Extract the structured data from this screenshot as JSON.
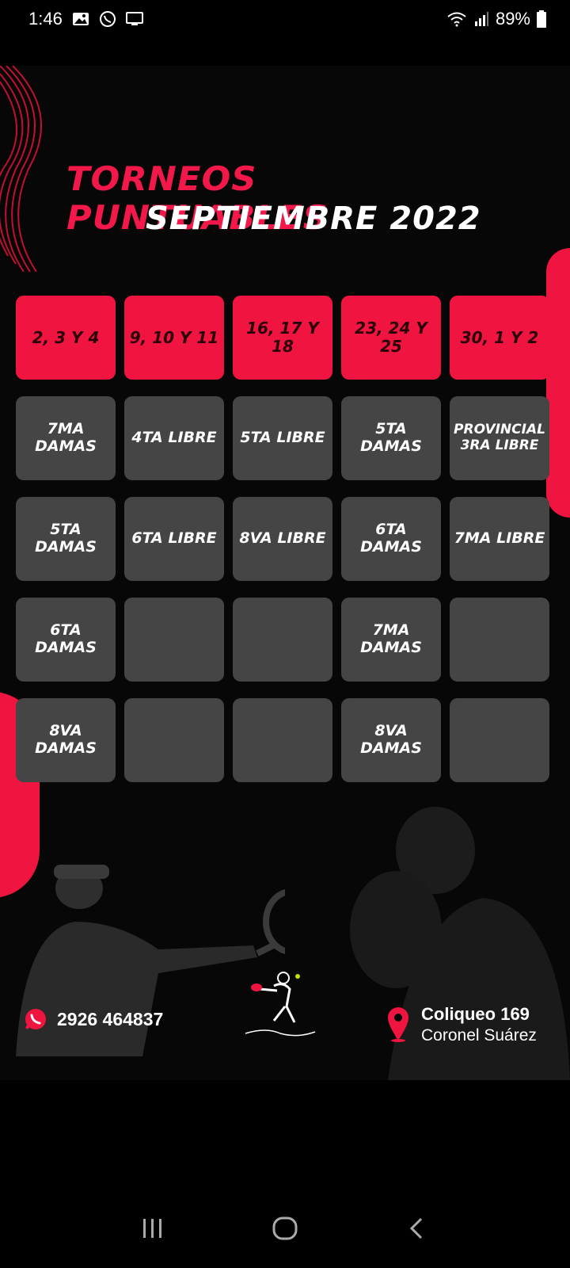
{
  "status_bar": {
    "time": "1:46",
    "battery": "89%",
    "icons": [
      "gallery-icon",
      "whatsapp-icon",
      "cast-icon",
      "wifi-icon",
      "signal-icon",
      "battery-icon"
    ]
  },
  "poster": {
    "title": "TORNEOS PUNTUABLES",
    "subtitle": "SEPTIEMBRE 2022",
    "dates": [
      "2, 3 Y 4",
      "9, 10 Y 11",
      "16, 17 Y 18",
      "23, 24 Y 25",
      "30, 1 Y 2"
    ],
    "rows": [
      [
        "7MA DAMAS",
        "4TA LIBRE",
        "5TA LIBRE",
        "5TA DAMAS",
        "PROVINCIAL 3RA LIBRE"
      ],
      [
        "5TA DAMAS",
        "6TA LIBRE",
        "8VA LIBRE",
        "6TA DAMAS",
        "7MA LIBRE"
      ],
      [
        "6TA DAMAS",
        "",
        "",
        "7MA DAMAS",
        ""
      ],
      [
        "8VA DAMAS",
        "",
        "",
        "8VA DAMAS",
        ""
      ]
    ],
    "phone": "2926 464837",
    "address_line1": "Coliqueo 169",
    "address_line2": "Coronel Suárez",
    "colors": {
      "accent": "#f01440",
      "cell": "#454545",
      "background": "#070707"
    }
  },
  "nav_bar": {
    "icons": [
      "recent-apps-icon",
      "home-icon",
      "back-icon"
    ]
  }
}
